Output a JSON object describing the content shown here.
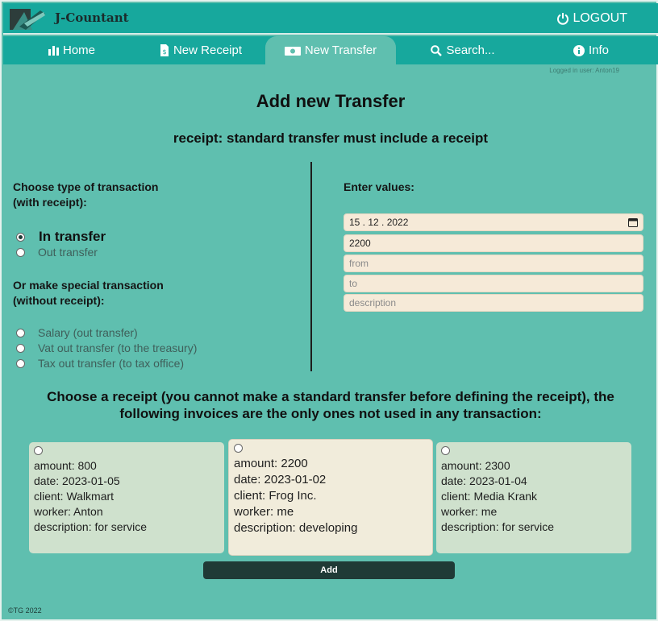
{
  "app": {
    "title": "J-Countant",
    "logout_label": "LOGOUT"
  },
  "nav": {
    "tabs": [
      {
        "label": "Home",
        "icon": "bar-chart-icon"
      },
      {
        "label": "New Receipt",
        "icon": "receipt-icon"
      },
      {
        "label": "New Transfer",
        "icon": "money-icon",
        "active": true
      },
      {
        "label": "Search...",
        "icon": "search-icon"
      },
      {
        "label": "Info",
        "icon": "info-icon"
      }
    ]
  },
  "logged_in": "Logged in user: Anton19",
  "page": {
    "title": "Add new Transfer",
    "subtitle": "receipt: standard transfer must include a receipt"
  },
  "left": {
    "type_heading_1": "Choose type of transaction",
    "type_heading_2": "(with receipt):",
    "options": [
      "In transfer",
      "Out transfer"
    ],
    "special_heading_1": "Or make special transaction",
    "special_heading_2": "(without receipt):",
    "special_options": [
      "Salary (out transfer)",
      "Vat out transfer (to the treasury)",
      "Tax out transfer (to tax office)"
    ]
  },
  "right": {
    "heading": "Enter values:",
    "date_value": "15 . 12 . 2022",
    "amount_value": "2200",
    "from_placeholder": "from",
    "to_placeholder": "to",
    "description_placeholder": "description"
  },
  "receipts": {
    "heading_1": "Choose a receipt (you cannot make a standard transfer before defining the receipt), the",
    "heading_2": "following invoices are the only ones not used in any transaction:",
    "cards": [
      {
        "amount": "amount: 800",
        "date": "date: 2023-01-05",
        "client": "client: Walkmart",
        "worker": "worker: Anton",
        "description": "description: for service"
      },
      {
        "amount": "amount: 2200",
        "date": "date: 2023-01-02",
        "client": "client: Frog Inc.",
        "worker": "worker: me",
        "description": "description: developing"
      },
      {
        "amount": "amount: 2300",
        "date": "date: 2023-01-04",
        "client": "client: Media Krank",
        "worker": "worker: me",
        "description": "description: for service"
      }
    ]
  },
  "add_label": "Add",
  "footer": "©TG 2022",
  "colors": {
    "header": "#17a89d",
    "background": "#5fbfaf",
    "button": "#1f3a36",
    "field": "#f6ead8"
  }
}
